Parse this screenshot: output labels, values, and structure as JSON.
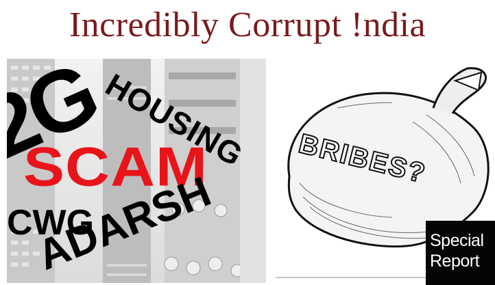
{
  "header": {
    "title": "Incredibly Corrupt !ndia"
  },
  "collage": {
    "words": {
      "w2g": "2G",
      "housing": "HOUSING",
      "scam": "SCAM",
      "cwg": "CWG",
      "adarsh": "ADARSH"
    },
    "icon": "skyscraper-photo"
  },
  "cartoon": {
    "bag_label": "BRIBES?",
    "icon": "money-bag-illustration"
  },
  "badge": {
    "line1": "Special",
    "line2": "Report"
  },
  "colors": {
    "title": "#7a1a1c",
    "scam": "#e8141a",
    "badge_bg": "#050505"
  }
}
